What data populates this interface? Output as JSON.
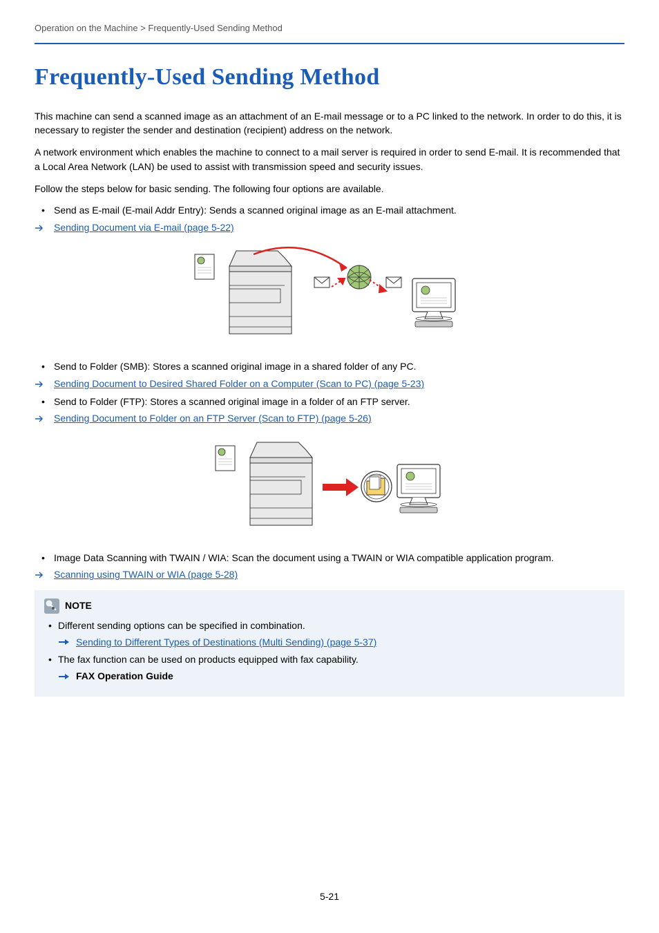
{
  "breadcrumb": "Operation on the Machine > Frequently-Used Sending Method",
  "title": "Frequently-Used Sending Method",
  "paragraphs": {
    "p1": "This machine can send a scanned image as an attachment of an E-mail message or to a PC linked to the network. In order to do this, it is necessary to register the sender and destination (recipient) address on the network.",
    "p2": "A network environment which enables the machine to connect to a mail server is required in order to send E-mail. It is recommended that a Local Area Network (LAN) be used to assist with transmission speed and security issues.",
    "p3": "Follow the steps below for basic sending. The following four options are available."
  },
  "items": {
    "email_bullet": "Send as E-mail (E-mail Addr Entry): Sends a scanned original image as an E-mail attachment.",
    "email_link": "Sending Document via E-mail (page 5-22)",
    "smb_bullet": "Send to Folder (SMB): Stores a scanned original image in a shared folder of any PC.",
    "smb_link": "Sending Document to Desired Shared Folder on a Computer (Scan to PC) (page 5-23)",
    "ftp_bullet": "Send to Folder (FTP): Stores a scanned original image in a folder of an FTP server.",
    "ftp_link": "Sending Document to Folder on an FTP Server (Scan to FTP) (page 5-26)",
    "twain_bullet": "Image Data Scanning with TWAIN / WIA: Scan the document using a TWAIN or WIA compatible application program.",
    "twain_link": "Scanning using TWAIN or WIA (page 5-28)"
  },
  "note": {
    "label": "NOTE",
    "line1": "Different sending options can be specified in combination.",
    "link1": "Sending to Different Types of Destinations (Multi Sending) (page 5-37)",
    "line2": "The fax function can be used on products equipped with fax capability.",
    "fax_guide": "FAX Operation Guide"
  },
  "page_number": "5-21"
}
